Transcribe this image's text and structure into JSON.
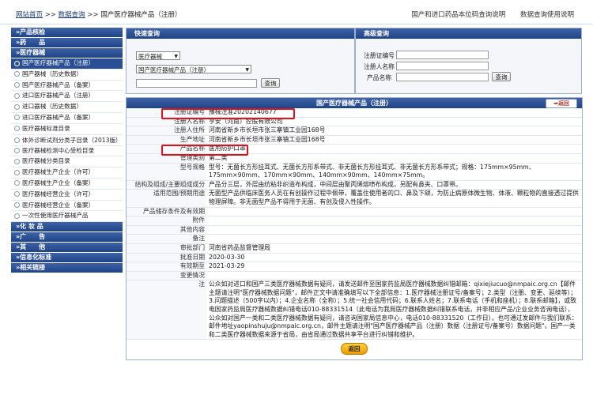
{
  "breadcrumb": {
    "home": "网站首页",
    "sep": " >> ",
    "query": "数据查询",
    "current": "国产医疗器械产品（注册）"
  },
  "top_links": [
    "国产和进口药品本位码查询说明",
    "数据查询使用说明"
  ],
  "sidebar": {
    "sections": [
      {
        "label": "»产品核检"
      },
      {
        "label": "»药　　品"
      },
      {
        "label": "»医疗器械"
      }
    ],
    "device_items": [
      {
        "label": "国产医疗器械产品（注册）",
        "active": true
      },
      {
        "label": "国产器械（历史数据）"
      },
      {
        "label": "国产医疗器械产品（备案）"
      },
      {
        "label": "进口医疗器械产品（注册）"
      },
      {
        "label": "进口器械（历史数据）"
      },
      {
        "label": "进口医疗器械产品（备案）"
      },
      {
        "label": "医疗器械标准目录"
      },
      {
        "label": "体外诊断试剂分类子目录（2013版）"
      },
      {
        "label": "医疗器械检测中心受检目录"
      },
      {
        "label": "医疗器械分类目录"
      },
      {
        "label": "医疗器械生产企业（许可）"
      },
      {
        "label": "医疗器械生产企业（备案）"
      },
      {
        "label": "医疗器械经营企业（许可）"
      },
      {
        "label": "医疗器械经营企业（备案）"
      },
      {
        "label": "一次性使用医疗器械产品"
      }
    ],
    "more_sections": [
      {
        "label": "»化 妆 品"
      },
      {
        "label": "»广　　告"
      },
      {
        "label": "»其　　他"
      },
      {
        "label": "»信息化标准"
      },
      {
        "label": "»相关链接"
      }
    ]
  },
  "quick_search": {
    "title": "快速查询",
    "category_select": "医疗器械",
    "sub_select": "国产医疗器械产品（注册）",
    "search_value": "",
    "button": "查询"
  },
  "advanced_search": {
    "title": "高级查询",
    "fields": [
      {
        "label": "注册证编号",
        "value": ""
      },
      {
        "label": "注册人名称",
        "value": ""
      },
      {
        "label": "产品名称",
        "value": ""
      }
    ],
    "button": "查询"
  },
  "result": {
    "title": "国产医疗器械产品（注册）",
    "back": "返回",
    "rows": [
      {
        "key": "注册证编号",
        "value": "豫械注准20202140677",
        "hl": true
      },
      {
        "key": "注册人名称",
        "value": "亨安（河南）控股有限公司"
      },
      {
        "key": "注册人住所",
        "value": "河南省新乡市长垣市张三寨镇工业园168号"
      },
      {
        "key": "生产地址",
        "value": "河南省新乡市长垣市张三寨镇工业园168号"
      },
      {
        "key": "产品名称",
        "value": "医用防护口罩",
        "hl": true
      },
      {
        "key": "管理类别",
        "value": "第二类"
      },
      {
        "key": "型号规格",
        "value": "型号：无菌长方形挂耳式、无菌长方形系带式、非无菌长方形挂耳式、非无菌长方形系带式；规格：175mm×95mm、175mm×90mm、170mm×90mm、140mm×90mm、140mm×75mm。"
      },
      {
        "key": "结构及组成/主要组成成分",
        "value": "产品分三层，外层由纺粘非织造布构成，中间层由聚丙烯熔喷布构成，另配有鼻夹、口罩带。"
      },
      {
        "key": "适用范围/预期用途",
        "value": "无菌型产品供临床医务人员在有创操作过程中佩带，覆盖住使用者的口、鼻及下颌，为防止病原体微生物、体液、颗粒物的直接透过提供物理屏障。非无菌型产品不得用于无菌、有创及侵入性操作。"
      },
      {
        "key": "产品储存条件及有效期",
        "value": ""
      },
      {
        "key": "附件",
        "value": ""
      },
      {
        "key": "其他内容",
        "value": ""
      },
      {
        "key": "备注",
        "value": ""
      },
      {
        "key": "审批部门",
        "value": "河南省药品监督管理局"
      },
      {
        "key": "批准日期",
        "value": "2020-03-30"
      },
      {
        "key": "有效期至",
        "value": "2021-03-29"
      },
      {
        "key": "变更情况",
        "value": ""
      },
      {
        "key": "注",
        "value": "公众如对进口和国产三类医疗器械数据有疑问，请发送邮件至国家药监局医疗器械数据纠错邮箱：qixiejiucuo@nmpaic.org.cn【邮件主题请注明\"医疗器械数据问题\"，邮件正文中请准确填写以下全部信息：1.医疗器械注册证号/备案号；2.类型（注册、变更、延续等）；3.问题描述（500字以内）；4.企业名称（全称）；5.统一社会信用代码；6.联系人姓名；7.联系电话（手机和座机）；8.联系邮箱】，或致电国家药监局医疗器械数据纠错电话010-88331514（此电话为我局医疗器械数据纠错联系电话，并非相应产品/企业业务咨询电话），公众如对国产一类和二类医疗器械数据有疑问，请咨询国家局信息中心，电话010-88331520（工作日），也可通过发邮件与我们联系：邮件地址yaopinshuju@nmpaic.org.cn，邮件主题请注明\"国产医疗器械产品（注册）数据（注册证号/备案号）数据问题\"。国产一类和二类医疗器械数据来源于省局，由省局通过数据共享平台进行纠错和维护。"
      }
    ],
    "return_btn": "返回"
  }
}
